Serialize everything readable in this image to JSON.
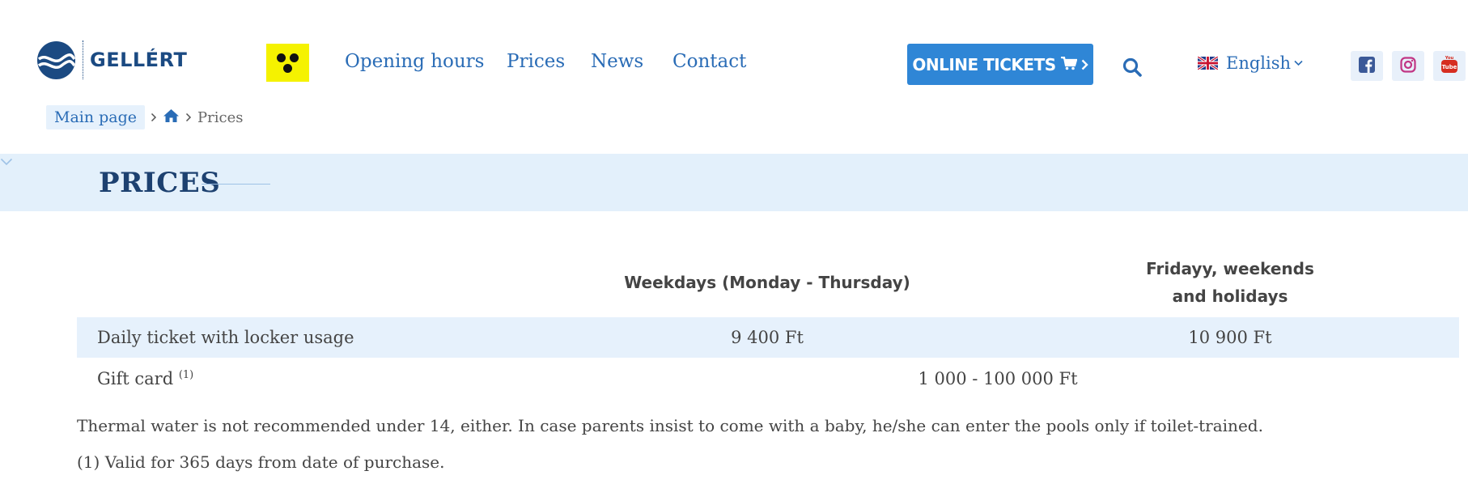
{
  "header": {
    "logo_text": "GELLÉRT",
    "nav": [
      {
        "label": "Opening hours"
      },
      {
        "label": "Prices"
      },
      {
        "label": "News"
      },
      {
        "label": "Contact"
      }
    ],
    "tickets_button": "ONLINE TICKETS",
    "language": "English",
    "social": [
      "facebook-icon",
      "instagram-icon",
      "youtube-icon"
    ],
    "colors": {
      "nav": "#2a6cb6",
      "button": "#2f86d6",
      "a11y": "#f5f200",
      "band": "#e3f0fb"
    }
  },
  "breadcrumb": {
    "main": "Main page",
    "current": "Prices"
  },
  "page": {
    "title": "PRICES"
  },
  "table": {
    "headers": {
      "weekdays": "Weekdays (Monday - Thursday)",
      "weekend_line1": "Fridayy, weekends",
      "weekend_line2": "and holidays"
    },
    "rows": [
      {
        "label": "Daily ticket with locker usage",
        "weekdays": "9 400 Ft",
        "weekend": "10 900 Ft"
      },
      {
        "label": "Gift card",
        "sup": "(1)",
        "merged": "1 000 - 100 000 Ft"
      }
    ]
  },
  "notes": [
    "Thermal water is not recommended under 14, either. In case parents insist to come with a baby, he/she can enter the pools only if toilet-trained.",
    "(1) Valid for 365 days from date of purchase."
  ]
}
